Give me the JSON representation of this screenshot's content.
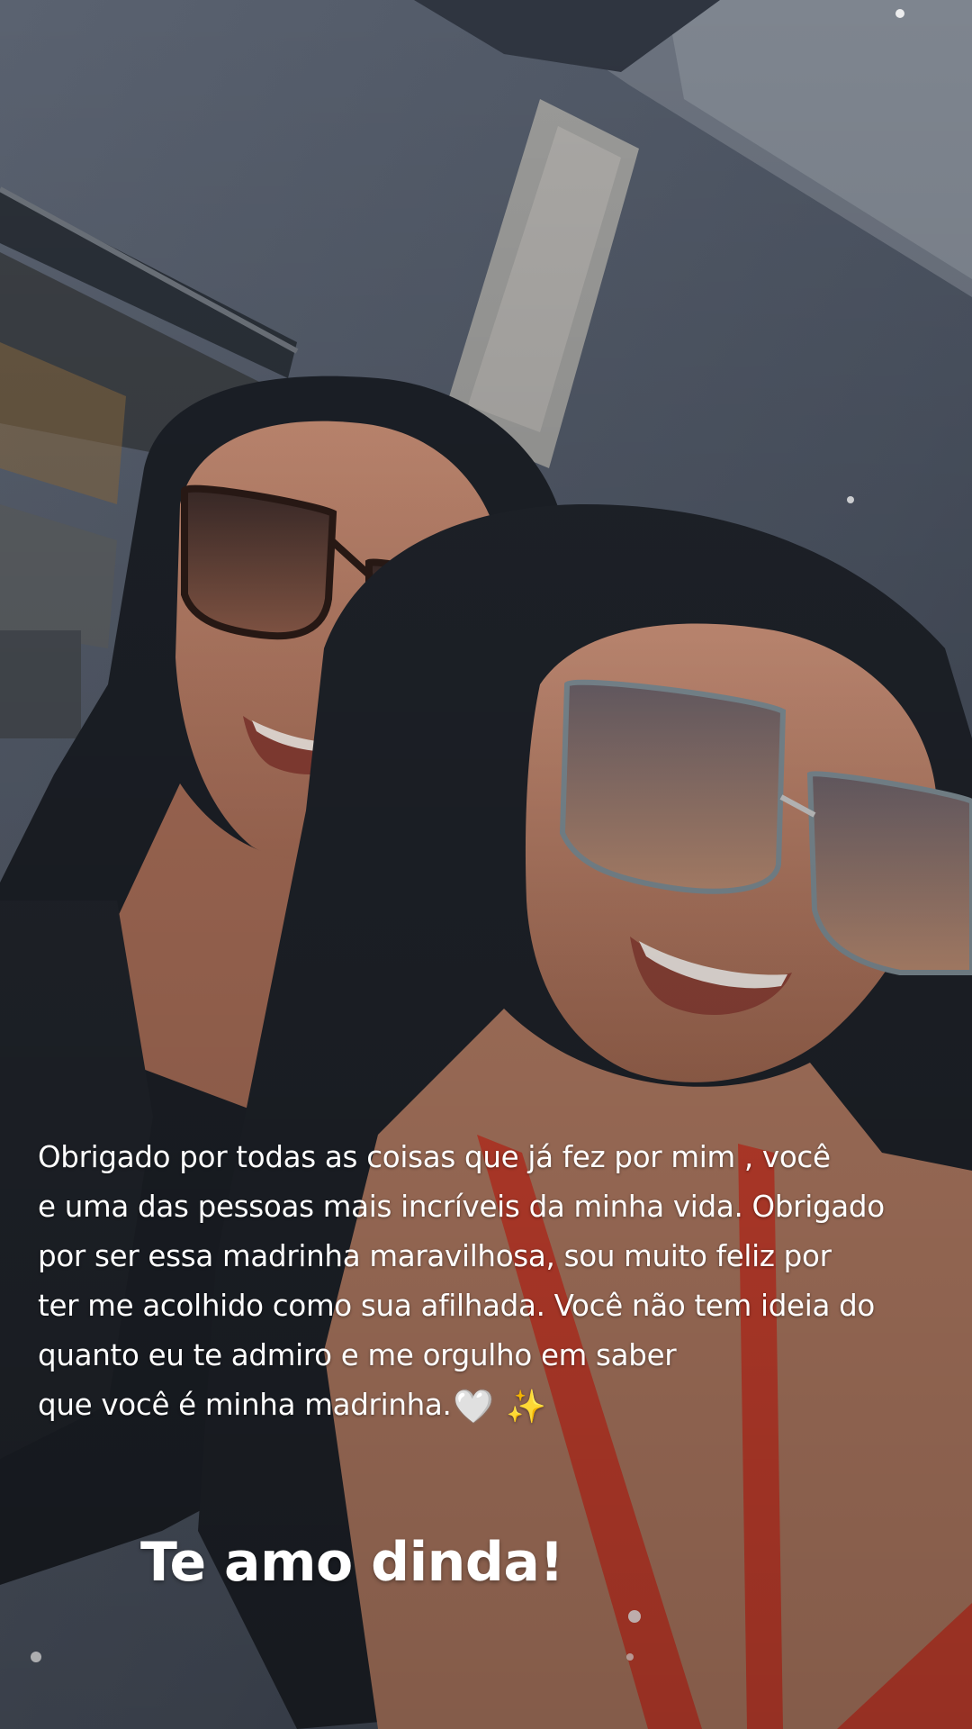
{
  "story": {
    "caption_lines": [
      "Obrigado por todas as coisas que já fez por mim , você",
      "e uma das pessoas mais incríveis da minha vida. Obrigado",
      "por ser essa madrinha maravilhosa, sou muito feliz por",
      "ter me acolhido como sua afilhada. Você não tem ideia do",
      "quanto eu te admiro e me orgulho em saber",
      "que você é minha madrinha."
    ],
    "caption_emojis": {
      "heart": "🤍",
      "sparkles": "✨"
    },
    "headline": "Te amo dinda!"
  },
  "photo": {
    "icon": "selfie-photo",
    "colors": {
      "wall": "#4a5260",
      "skin": "#b98068",
      "hair": "#1c2027",
      "swimsuit": "#c8402e"
    }
  }
}
